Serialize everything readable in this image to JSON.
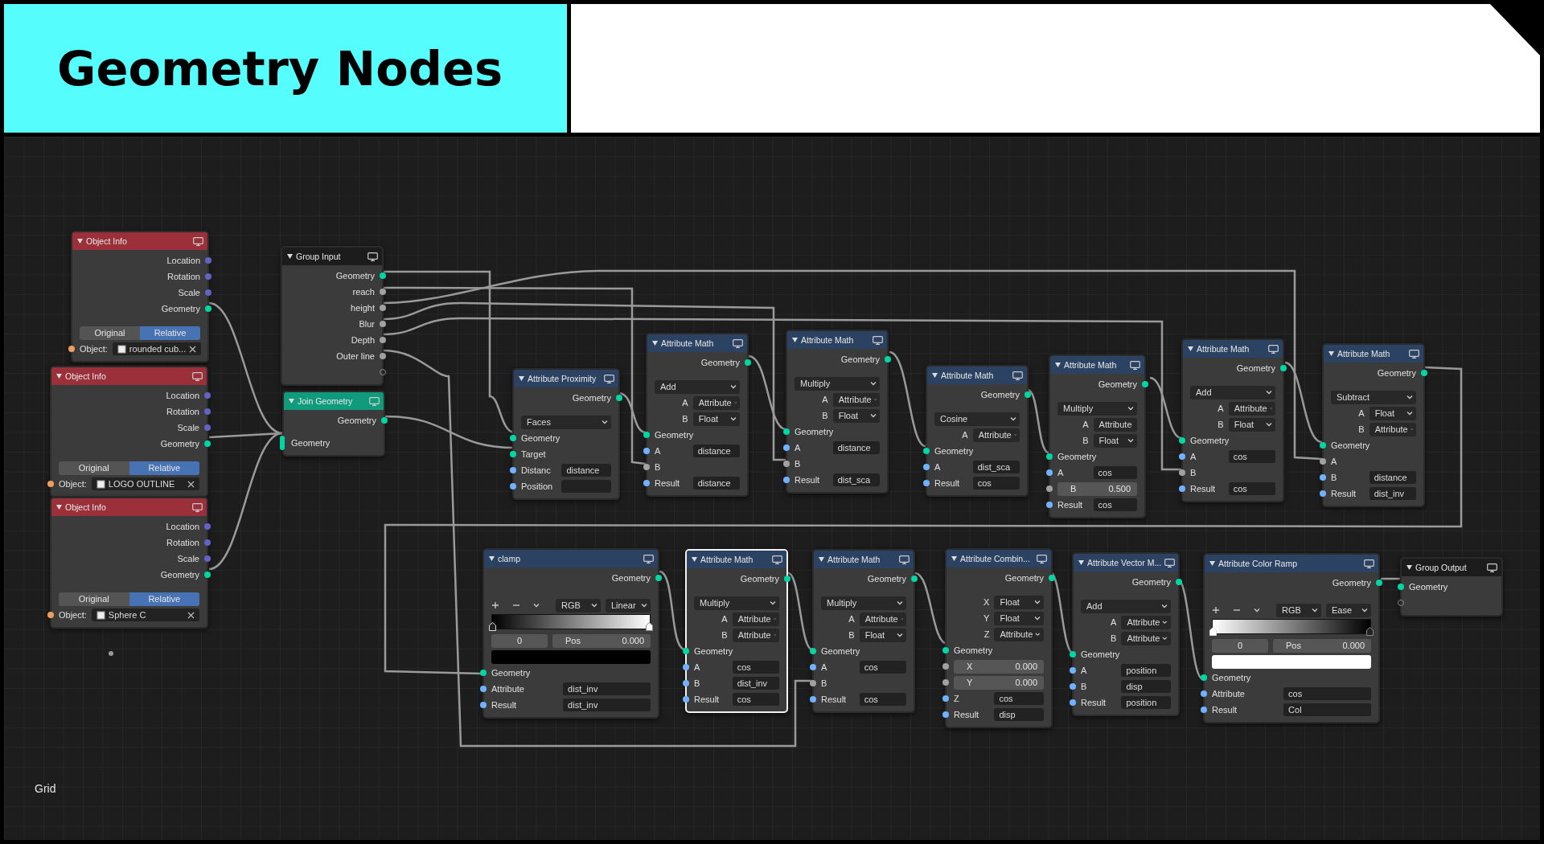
{
  "header": {
    "title": "Geometry Nodes"
  },
  "canvas": {
    "label": "Grid"
  },
  "nodes": [
    {
      "title": "Object Info",
      "color": "#9b2f3a",
      "selected": false,
      "rows": [
        {
          "kind": "output",
          "label": "Location",
          "color": "#6363c7"
        },
        {
          "kind": "output",
          "label": "Rotation",
          "color": "#6363c7"
        },
        {
          "kind": "output",
          "label": "Scale",
          "color": "#6363c7"
        },
        {
          "kind": "output",
          "label": "Geometry",
          "color": "#00d6a3"
        },
        {
          "kind": "toggle",
          "options": [
            {
              "label": "Original",
              "selected": false
            },
            {
              "label": "Relative",
              "selected": true
            }
          ]
        },
        {
          "kind": "object",
          "label": "Object:",
          "value": "rounded cub...",
          "color": "#ed9e5c"
        }
      ]
    },
    {
      "title": "Object Info",
      "color": "#9b2f3a",
      "selected": false,
      "rows": [
        {
          "kind": "output",
          "label": "Location",
          "color": "#6363c7"
        },
        {
          "kind": "output",
          "label": "Rotation",
          "color": "#6363c7"
        },
        {
          "kind": "output",
          "label": "Scale",
          "color": "#6363c7"
        },
        {
          "kind": "output",
          "label": "Geometry",
          "color": "#00d6a3"
        },
        {
          "kind": "toggle",
          "options": [
            {
              "label": "Original",
              "selected": false
            },
            {
              "label": "Relative",
              "selected": true
            }
          ]
        },
        {
          "kind": "object",
          "label": "Object:",
          "value": "LOGO OUTLINE",
          "color": "#ed9e5c"
        }
      ]
    },
    {
      "title": "Object Info",
      "color": "#9b2f3a",
      "selected": false,
      "rows": [
        {
          "kind": "output",
          "label": "Location",
          "color": "#6363c7"
        },
        {
          "kind": "output",
          "label": "Rotation",
          "color": "#6363c7"
        },
        {
          "kind": "output",
          "label": "Scale",
          "color": "#6363c7"
        },
        {
          "kind": "output",
          "label": "Geometry",
          "color": "#00d6a3"
        },
        {
          "kind": "toggle",
          "options": [
            {
              "label": "Original",
              "selected": false
            },
            {
              "label": "Relative",
              "selected": true
            }
          ]
        },
        {
          "kind": "object",
          "label": "Object:",
          "value": "Sphere C",
          "color": "#ed9e5c"
        }
      ]
    },
    {
      "title": "Group Input",
      "color": "#1c1c1c",
      "selected": false,
      "rows": [
        {
          "kind": "output",
          "label": "Geometry",
          "color": "#00d6a3"
        },
        {
          "kind": "output",
          "label": "reach",
          "color": "#a1a1a1"
        },
        {
          "kind": "output",
          "label": "height",
          "color": "#a1a1a1"
        },
        {
          "kind": "output",
          "label": "Blur",
          "color": "#a1a1a1"
        },
        {
          "kind": "output",
          "label": "Depth",
          "color": "#a1a1a1"
        },
        {
          "kind": "output",
          "label": "Outer line",
          "color": "#a1a1a1"
        },
        {
          "kind": "virtualout"
        }
      ]
    },
    {
      "title": "Join Geometry",
      "color": "#0f9b7c",
      "selected": false,
      "rows": [
        {
          "kind": "output",
          "label": "Geometry",
          "color": "#00d6a3"
        },
        {
          "kind": "multiinput",
          "label": "Geometry",
          "color": "#00d6a3"
        }
      ]
    },
    {
      "title": "Attribute Proximity",
      "color": "#2c4263",
      "selected": false,
      "rows": [
        {
          "kind": "output",
          "label": "Geometry",
          "color": "#00d6a3"
        },
        {
          "kind": "dropdown",
          "value": "Faces"
        },
        {
          "kind": "input",
          "label": "Geometry",
          "color": "#00d6a3"
        },
        {
          "kind": "input",
          "label": "Target",
          "color": "#00d6a3"
        },
        {
          "kind": "input",
          "label": "Distanc",
          "color": "#70b2ff",
          "value": "distance"
        },
        {
          "kind": "input",
          "label": "Position",
          "color": "#70b2ff",
          "empty_field": true
        }
      ]
    },
    {
      "title": "Attribute Math",
      "color": "#2c4263",
      "selected": false,
      "rows": [
        {
          "kind": "output",
          "label": "Geometry",
          "color": "#00d6a3"
        },
        {
          "kind": "dropdown",
          "value": "Add"
        },
        {
          "kind": "choice",
          "label": "A",
          "value": "Attribute"
        },
        {
          "kind": "choice",
          "label": "B",
          "value": "Float"
        },
        {
          "kind": "input",
          "label": "Geometry",
          "color": "#00d6a3"
        },
        {
          "kind": "input",
          "label": "A",
          "color": "#70b2ff",
          "value": "distance"
        },
        {
          "kind": "input",
          "label": "B",
          "color": "#a1a1a1"
        },
        {
          "kind": "input",
          "label": "Result",
          "color": "#70b2ff",
          "value": "distance"
        }
      ]
    },
    {
      "title": "Attribute Math",
      "color": "#2c4263",
      "selected": false,
      "rows": [
        {
          "kind": "output",
          "label": "Geometry",
          "color": "#00d6a3"
        },
        {
          "kind": "dropdown",
          "value": "Multiply"
        },
        {
          "kind": "choice",
          "label": "A",
          "value": "Attribute"
        },
        {
          "kind": "choice",
          "label": "B",
          "value": "Float"
        },
        {
          "kind": "input",
          "label": "Geometry",
          "color": "#00d6a3"
        },
        {
          "kind": "input",
          "label": "A",
          "color": "#70b2ff",
          "value": "distance"
        },
        {
          "kind": "input",
          "label": "B",
          "color": "#a1a1a1"
        },
        {
          "kind": "input",
          "label": "Result",
          "color": "#70b2ff",
          "value": "dist_sca"
        }
      ]
    },
    {
      "title": "Attribute Math",
      "color": "#2c4263",
      "selected": false,
      "rows": [
        {
          "kind": "output",
          "label": "Geometry",
          "color": "#00d6a3"
        },
        {
          "kind": "dropdown",
          "value": "Cosine"
        },
        {
          "kind": "choice",
          "label": "A",
          "value": "Attribute"
        },
        {
          "kind": "input",
          "label": "Geometry",
          "color": "#00d6a3"
        },
        {
          "kind": "input",
          "label": "A",
          "color": "#70b2ff",
          "value": "dist_sca"
        },
        {
          "kind": "input",
          "label": "Result",
          "color": "#70b2ff",
          "value": "cos"
        }
      ]
    },
    {
      "title": "Attribute Math",
      "color": "#2c4263",
      "selected": false,
      "rows": [
        {
          "kind": "output",
          "label": "Geometry",
          "color": "#00d6a3"
        },
        {
          "kind": "dropdown",
          "value": "Multiply"
        },
        {
          "kind": "choice",
          "label": "A",
          "value": "Attribute"
        },
        {
          "kind": "choice",
          "label": "B",
          "value": "Float"
        },
        {
          "kind": "input",
          "label": "Geometry",
          "color": "#00d6a3"
        },
        {
          "kind": "input",
          "label": "A",
          "color": "#70b2ff",
          "value": "cos"
        },
        {
          "kind": "number",
          "label": "B",
          "value": "0.500",
          "color": "#a1a1a1"
        },
        {
          "kind": "input",
          "label": "Result",
          "color": "#70b2ff",
          "value": "cos"
        }
      ]
    },
    {
      "title": "Attribute Math",
      "color": "#2c4263",
      "selected": false,
      "rows": [
        {
          "kind": "output",
          "label": "Geometry",
          "color": "#00d6a3"
        },
        {
          "kind": "dropdown",
          "value": "Add"
        },
        {
          "kind": "choice",
          "label": "A",
          "value": "Attribute"
        },
        {
          "kind": "choice",
          "label": "B",
          "value": "Float"
        },
        {
          "kind": "input",
          "label": "Geometry",
          "color": "#00d6a3"
        },
        {
          "kind": "input",
          "label": "A",
          "color": "#70b2ff",
          "value": "cos"
        },
        {
          "kind": "input",
          "label": "B",
          "color": "#a1a1a1"
        },
        {
          "kind": "input",
          "label": "Result",
          "color": "#70b2ff",
          "value": "cos"
        }
      ]
    },
    {
      "title": "Attribute Math",
      "color": "#2c4263",
      "selected": false,
      "rows": [
        {
          "kind": "output",
          "label": "Geometry",
          "color": "#00d6a3"
        },
        {
          "kind": "dropdown",
          "value": "Subtract"
        },
        {
          "kind": "choice",
          "label": "A",
          "value": "Float"
        },
        {
          "kind": "choice",
          "label": "B",
          "value": "Attribute"
        },
        {
          "kind": "input",
          "label": "Geometry",
          "color": "#00d6a3"
        },
        {
          "kind": "input",
          "label": "A",
          "color": "#a1a1a1"
        },
        {
          "kind": "input",
          "label": "B",
          "color": "#70b2ff",
          "value": "distance"
        },
        {
          "kind": "input",
          "label": "Result",
          "color": "#70b2ff",
          "value": "dist_inv"
        }
      ]
    },
    {
      "title": "clamp",
      "color": "#2c4263",
      "selected": false,
      "rows": [
        {
          "kind": "output",
          "label": "Geometry",
          "color": "#00d6a3"
        },
        {
          "kind": "rampcontrols",
          "options": [
            "RGB",
            "Linear"
          ]
        },
        {
          "kind": "ramp",
          "reversed": false
        },
        {
          "kind": "rampstop",
          "index": "0",
          "label": "Pos",
          "value": "0.000"
        },
        {
          "kind": "swatch",
          "color": "#000000"
        },
        {
          "kind": "input",
          "label": "Geometry",
          "color": "#00d6a3"
        },
        {
          "kind": "input",
          "label": "Attribute",
          "color": "#70b2ff",
          "value": "dist_inv"
        },
        {
          "kind": "input",
          "label": "Result",
          "color": "#70b2ff",
          "value": "dist_inv"
        }
      ]
    },
    {
      "title": "Attribute Math",
      "color": "#2c4263",
      "selected": true,
      "rows": [
        {
          "kind": "output",
          "label": "Geometry",
          "color": "#00d6a3"
        },
        {
          "kind": "dropdown",
          "value": "Multiply"
        },
        {
          "kind": "choice",
          "label": "A",
          "value": "Attribute"
        },
        {
          "kind": "choice",
          "label": "B",
          "value": "Attribute"
        },
        {
          "kind": "input",
          "label": "Geometry",
          "color": "#00d6a3"
        },
        {
          "kind": "input",
          "label": "A",
          "color": "#70b2ff",
          "value": "cos"
        },
        {
          "kind": "input",
          "label": "B",
          "color": "#70b2ff",
          "value": "dist_inv"
        },
        {
          "kind": "input",
          "label": "Result",
          "color": "#70b2ff",
          "value": "cos"
        }
      ]
    },
    {
      "title": "Attribute Math",
      "color": "#2c4263",
      "selected": false,
      "rows": [
        {
          "kind": "output",
          "label": "Geometry",
          "color": "#00d6a3"
        },
        {
          "kind": "dropdown",
          "value": "Multiply"
        },
        {
          "kind": "choice",
          "label": "A",
          "value": "Attribute"
        },
        {
          "kind": "choice",
          "label": "B",
          "value": "Float"
        },
        {
          "kind": "input",
          "label": "Geometry",
          "color": "#00d6a3"
        },
        {
          "kind": "input",
          "label": "A",
          "color": "#70b2ff",
          "value": "cos"
        },
        {
          "kind": "input",
          "label": "B",
          "color": "#a1a1a1"
        },
        {
          "kind": "input",
          "label": "Result",
          "color": "#70b2ff",
          "value": "cos"
        }
      ]
    },
    {
      "title": "Attribute Combin...",
      "color": "#2c4263",
      "selected": false,
      "rows": [
        {
          "kind": "output",
          "label": "Geometry",
          "color": "#00d6a3"
        },
        {
          "kind": "choice",
          "label": "X",
          "value": "Float"
        },
        {
          "kind": "choice",
          "label": "Y",
          "value": "Float"
        },
        {
          "kind": "choice",
          "label": "Z",
          "value": "Attribute"
        },
        {
          "kind": "input",
          "label": "Geometry",
          "color": "#00d6a3"
        },
        {
          "kind": "number",
          "label": "X",
          "value": "0.000",
          "color": "#a1a1a1"
        },
        {
          "kind": "number",
          "label": "Y",
          "value": "0.000",
          "color": "#a1a1a1"
        },
        {
          "kind": "input",
          "label": "Z",
          "color": "#70b2ff",
          "value": "cos"
        },
        {
          "kind": "input",
          "label": "Result",
          "color": "#70b2ff",
          "value": "disp"
        }
      ]
    },
    {
      "title": "Attribute Vector M...",
      "color": "#2c4263",
      "selected": false,
      "rows": [
        {
          "kind": "output",
          "label": "Geometry",
          "color": "#00d6a3"
        },
        {
          "kind": "dropdown",
          "value": "Add"
        },
        {
          "kind": "choice",
          "label": "A",
          "value": "Attribute"
        },
        {
          "kind": "choice",
          "label": "B",
          "value": "Attribute"
        },
        {
          "kind": "input",
          "label": "Geometry",
          "color": "#00d6a3"
        },
        {
          "kind": "input",
          "label": "A",
          "color": "#70b2ff",
          "value": "position"
        },
        {
          "kind": "input",
          "label": "B",
          "color": "#70b2ff",
          "value": "disp"
        },
        {
          "kind": "input",
          "label": "Result",
          "color": "#70b2ff",
          "value": "position"
        }
      ]
    },
    {
      "title": "Attribute Color Ramp",
      "color": "#2c4263",
      "selected": false,
      "rows": [
        {
          "kind": "output",
          "label": "Geometry",
          "color": "#00d6a3"
        },
        {
          "kind": "rampcontrols",
          "options": [
            "RGB",
            "Ease"
          ]
        },
        {
          "kind": "ramp",
          "reversed": true
        },
        {
          "kind": "rampstop",
          "index": "0",
          "label": "Pos",
          "value": "0.000"
        },
        {
          "kind": "swatch",
          "color": "#ffffff"
        },
        {
          "kind": "input",
          "label": "Geometry",
          "color": "#00d6a3"
        },
        {
          "kind": "input",
          "label": "Attribute",
          "color": "#70b2ff",
          "value": "cos"
        },
        {
          "kind": "input",
          "label": "Result",
          "color": "#70b2ff",
          "value": "Col"
        }
      ]
    },
    {
      "title": "Group Output",
      "color": "#1c1c1c",
      "selected": false,
      "rows": [
        {
          "kind": "input",
          "label": "Geometry",
          "color": "#00d6a3"
        },
        {
          "kind": "virtualin"
        }
      ]
    }
  ]
}
